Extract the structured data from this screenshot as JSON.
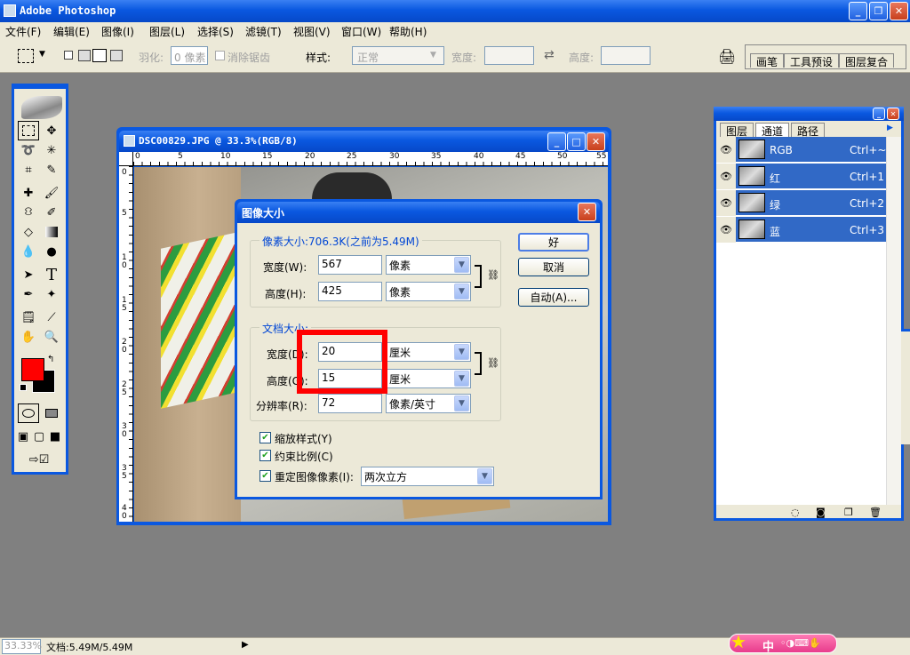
{
  "app": {
    "title": "Adobe Photoshop"
  },
  "menu": [
    "文件(F)",
    "编辑(E)",
    "图像(I)",
    "图层(L)",
    "选择(S)",
    "滤镜(T)",
    "视图(V)",
    "窗口(W)",
    "帮助(H)"
  ],
  "options": {
    "feather_label": "羽化:",
    "feather_value": "0 像素",
    "antialias_label": "消除锯齿",
    "style_label": "样式:",
    "style_value": "正常",
    "width_label": "宽度:",
    "height_label": "高度:"
  },
  "palette_tabs": [
    "画笔",
    "工具预设",
    "图层复合"
  ],
  "document": {
    "title": "DSC00829.JPG @ 33.3%(RGB/8)",
    "ruler_top": [
      "0",
      "5",
      "10",
      "15",
      "20",
      "25",
      "30",
      "35",
      "40",
      "45",
      "50",
      "55"
    ],
    "ruler_left": [
      "0",
      "5",
      "1",
      "0",
      "1",
      "5",
      "2",
      "0",
      "2",
      "5",
      "3",
      "0",
      "3",
      "5",
      "4",
      "0"
    ]
  },
  "dialog": {
    "title": "图像大小",
    "pixel_group": "像素大小:706.3K(之前为5.49M)",
    "width_label": "宽度(W):",
    "width_value": "567",
    "width_unit": "像素",
    "height_label": "高度(H):",
    "height_value": "425",
    "height_unit": "像素",
    "doc_group": "文档大小:",
    "doc_width_label": "宽度(D):",
    "doc_width_value": "20",
    "doc_width_unit": "厘米",
    "doc_height_label": "高度(G):",
    "doc_height_value": "15",
    "doc_height_unit": "厘米",
    "res_label": "分辨率(R):",
    "res_value": "72",
    "res_unit": "像素/英寸",
    "scale_styles": "缩放样式(Y)",
    "constrain": "约束比例(C)",
    "resample": "重定图像像素(I):",
    "resample_method": "两次立方",
    "ok": "好",
    "cancel": "取消",
    "auto": "自动(A)..."
  },
  "channels": {
    "tabs": [
      "图层",
      "通道",
      "路径"
    ],
    "rows": [
      {
        "name": "RGB",
        "key": "Ctrl+~"
      },
      {
        "name": "红",
        "key": "Ctrl+1"
      },
      {
        "name": "绿",
        "key": "Ctrl+2"
      },
      {
        "name": "蓝",
        "key": "Ctrl+3"
      }
    ]
  },
  "status": {
    "zoom": "33.33%",
    "doc": "文档:5.49M/5.49M"
  },
  "ime": {
    "label": "中"
  },
  "colors": {
    "foreground": "#ff0000",
    "background": "#000000",
    "highlight": "#ff0000"
  }
}
